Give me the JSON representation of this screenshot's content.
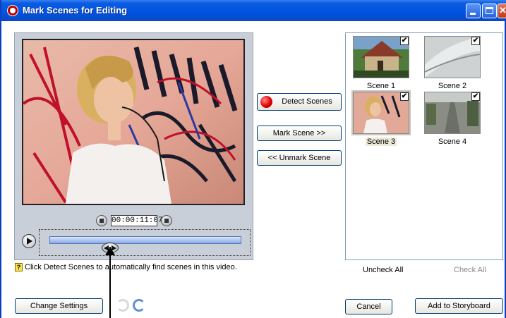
{
  "window": {
    "title": "Mark Scenes for Editing"
  },
  "preview": {
    "timecode": "00:00:11:07"
  },
  "buttons": {
    "detect": "Detect Scenes",
    "mark": "Mark Scene >>",
    "unmark": "<< Unmark Scene",
    "change_settings": "Change Settings",
    "cancel": "Cancel",
    "add_storyboard": "Add to Storyboard"
  },
  "hint": {
    "text": "Click Detect Scenes to automatically find scenes in this video.",
    "icon": "?"
  },
  "scenes": [
    {
      "label": "Scene 1",
      "checked": true
    },
    {
      "label": "Scene 2",
      "checked": true
    },
    {
      "label": "Scene 3",
      "checked": true,
      "selected": true
    },
    {
      "label": "Scene 4",
      "checked": true
    }
  ],
  "links": {
    "uncheck_all": "Uncheck All",
    "check_all": "Check All"
  },
  "colors": {
    "titlebar": "#0053e0",
    "record": "#e00000",
    "panel_border": "#7f9db9"
  },
  "icons": [
    "app-icon",
    "minimize-icon",
    "maximize-icon",
    "close-icon",
    "step-back-icon",
    "step-forward-icon",
    "play-icon",
    "record-icon",
    "undo-icon",
    "redo-icon",
    "help-icon",
    "checkmark-icon"
  ]
}
